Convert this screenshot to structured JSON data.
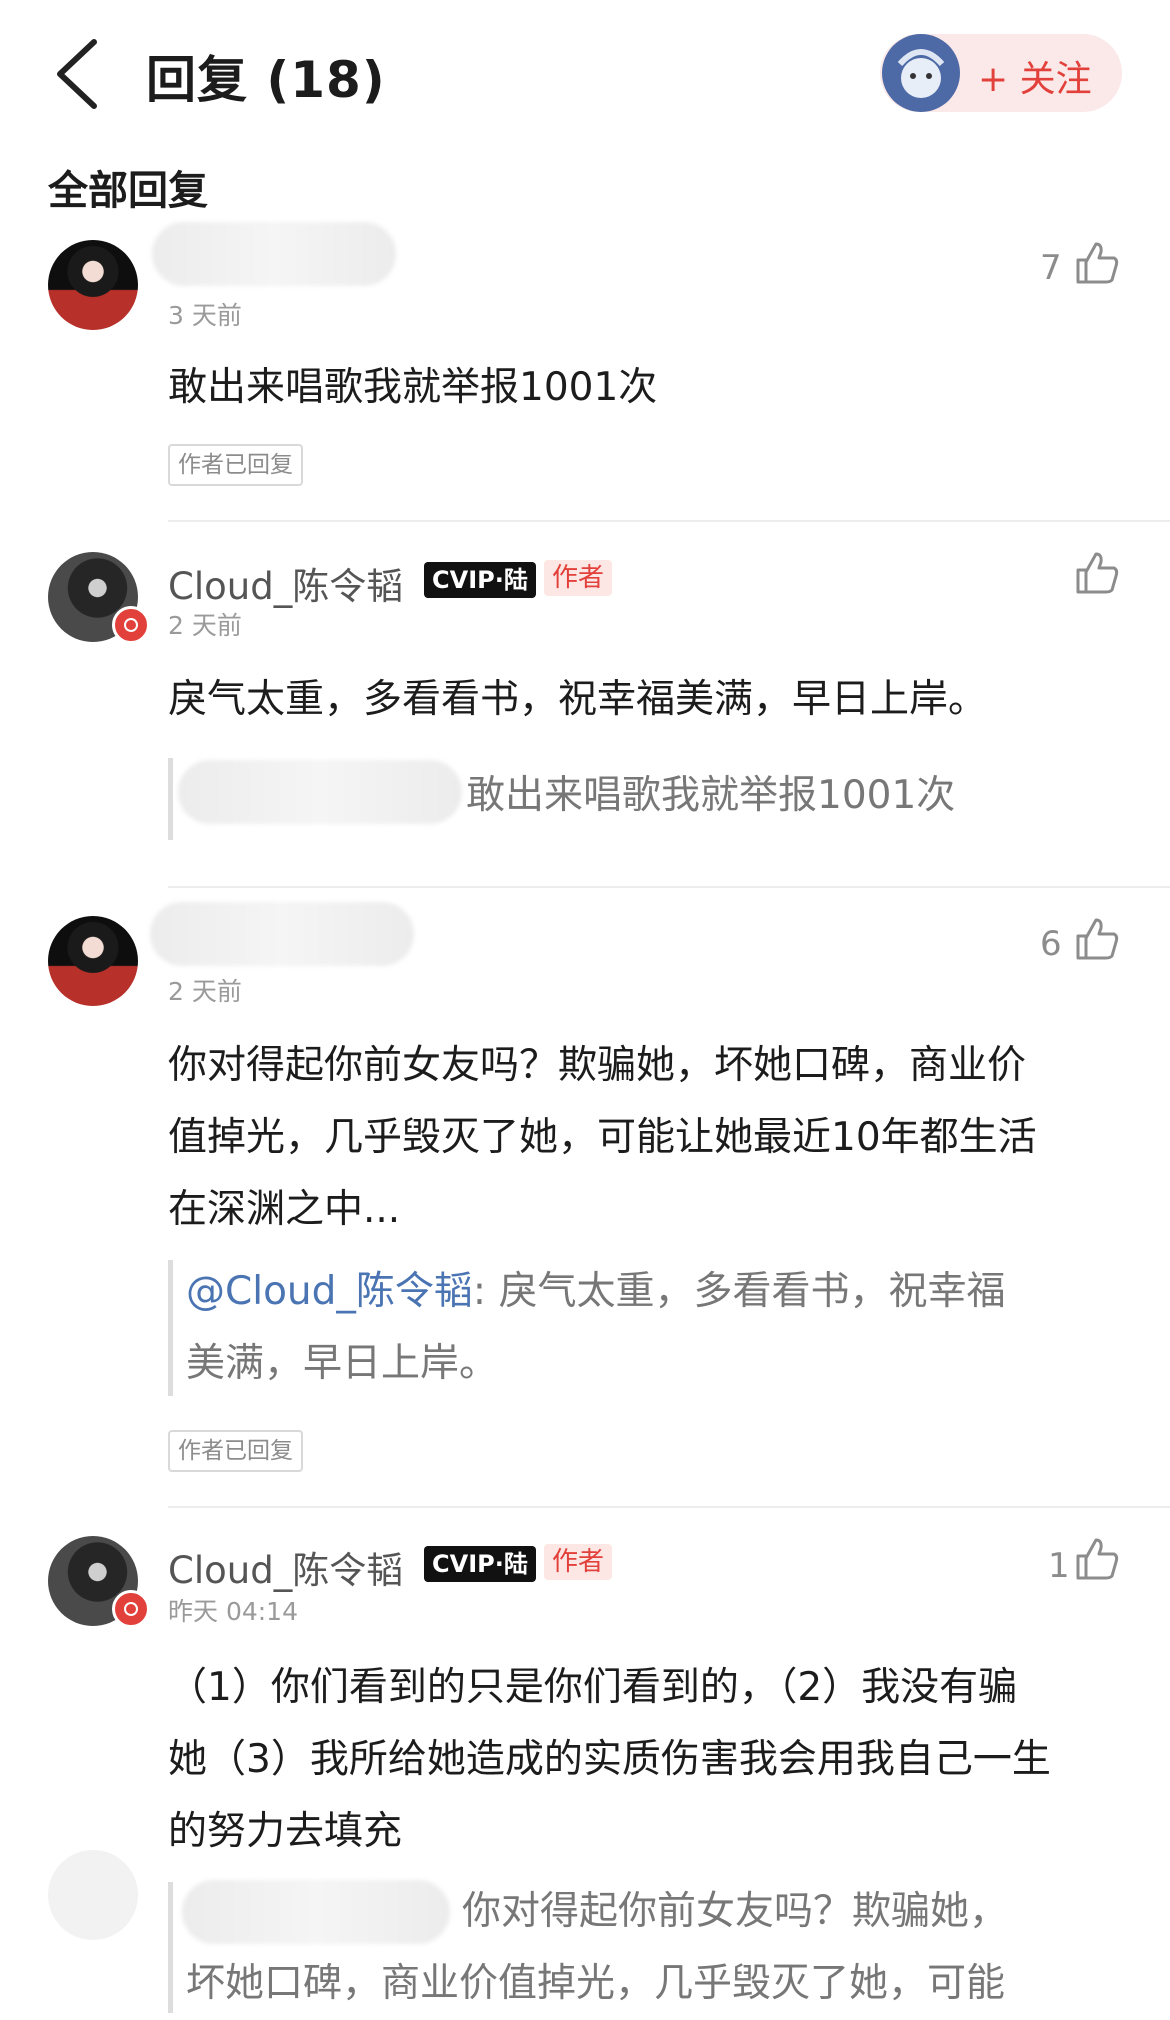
{
  "header": {
    "title": "回复 (18)",
    "follow_label": "+ 关注"
  },
  "section_title": "全部回复",
  "comments": [
    {
      "time": "3 天前",
      "likes": "7",
      "text": "敢出来唱歌我就举报1001次",
      "reply_tag": "作者已回复"
    },
    {
      "name": "Cloud_陈令韬",
      "vip": "CVIP·陆",
      "author_tag": "作者",
      "time": "2 天前",
      "text": "戾气太重，多看看书，祝幸福美满，早日上岸。",
      "quote_text": "敢出来唱歌我就举报1001次"
    },
    {
      "time": "2 天前",
      "likes": "6",
      "text_lines": [
        "你对得起你前女友吗？欺骗她，坏她口碑，商业价",
        "值掉光，几乎毁灭了她，可能让她最近10年都生活",
        "在深渊之中..."
      ],
      "quote_mention": "@Cloud_陈令韬",
      "quote_line1": ": 戾气太重，多看看书，祝幸福",
      "quote_line2": "美满，早日上岸。",
      "reply_tag": "作者已回复"
    },
    {
      "name": "Cloud_陈令韬",
      "vip": "CVIP·陆",
      "author_tag": "作者",
      "time": "昨天 04:14",
      "likes": "1",
      "text_lines": [
        "（1）你们看到的只是你们看到的，（2）我没有骗",
        "她（3）我所给她造成的实质伤害我会用我自己一生",
        "的努力去填充"
      ],
      "quote_line1": "你对得起你前女友吗？欺骗她，",
      "quote_line2": "坏她口碑，商业价值掉光，几乎毁灭了她，可能"
    }
  ],
  "colors": {
    "accent": "#e2403a",
    "mention": "#4b74b3",
    "follow_bg": "#fbe8e8"
  },
  "icons": {
    "back": "chevron-left-icon",
    "like": "thumbs-up-icon",
    "music_badge": "music-badge-icon"
  }
}
